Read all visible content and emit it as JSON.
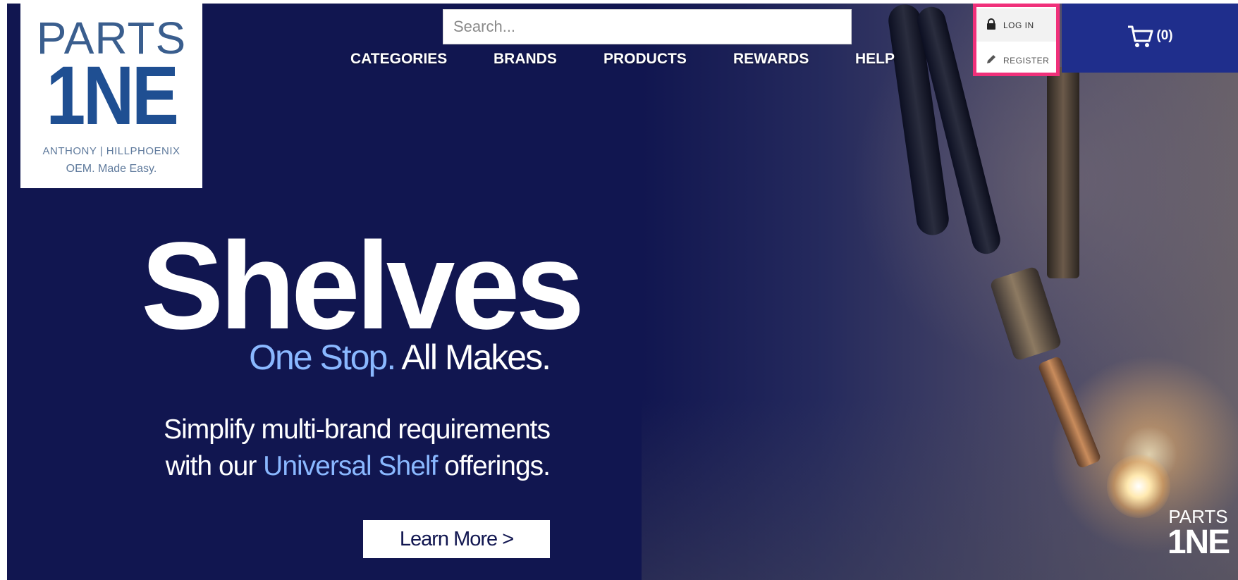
{
  "logo": {
    "parts": "PARTS",
    "one": "1NE",
    "sub": "ANTHONY | HILLPHOENIX",
    "tagline": "OEM. Made Easy."
  },
  "search": {
    "placeholder": "Search..."
  },
  "nav": {
    "items": [
      "CATEGORIES",
      "BRANDS",
      "PRODUCTS",
      "REWARDS",
      "HELP"
    ]
  },
  "account": {
    "login_label": "LOG IN",
    "register_label": "REGISTER"
  },
  "cart": {
    "count": "(0)"
  },
  "hero": {
    "title": "Shelves",
    "tagline_highlight": "One Stop.",
    "tagline_rest": "All Makes.",
    "desc_line1": "Simplify multi-brand requirements",
    "desc_line2_pre": "with our",
    "desc_line2_highlight": "Universal Shelf",
    "desc_line2_post": "offerings.",
    "cta": "Learn More >"
  },
  "watermark": {
    "parts": "PARTS",
    "one": "1NE"
  },
  "colors": {
    "background": "#111650",
    "accent_blue": "#8ab8ff",
    "cart_bg": "#1f2e8c",
    "highlight_border": "#f0307a"
  }
}
